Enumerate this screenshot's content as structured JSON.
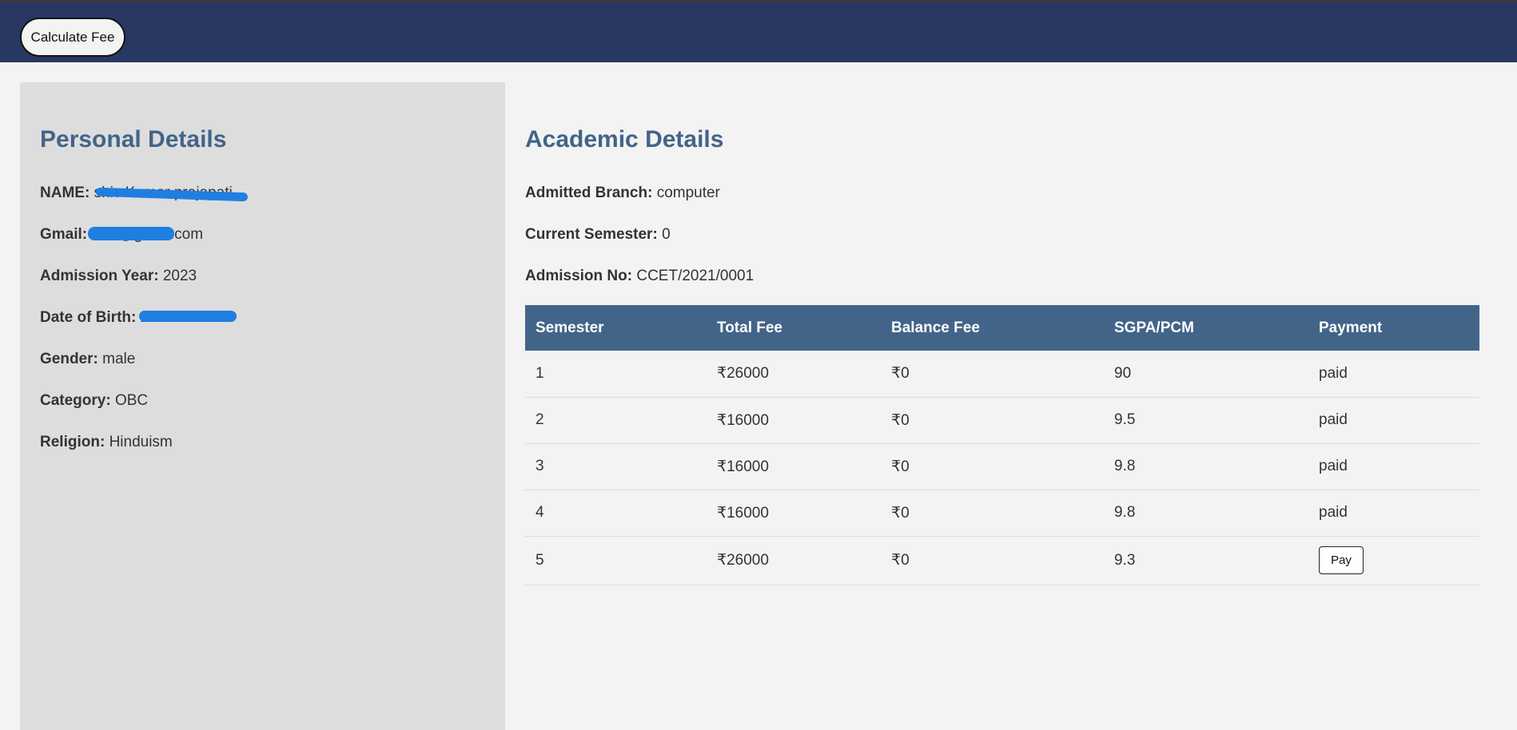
{
  "header": {
    "calculate_fee_label": "Calculate Fee",
    "background_color": "#283862"
  },
  "personal": {
    "title": "Personal Details",
    "fields": [
      {
        "label": "NAME:",
        "value": "shiv Kumar prajapati"
      },
      {
        "label": "Gmail:",
        "value": "shiv@gmail.com"
      },
      {
        "label": "Admission Year:",
        "value": "2023"
      },
      {
        "label": "Date of Birth:",
        "value": "2002-08-00"
      },
      {
        "label": "Gender:",
        "value": "male"
      },
      {
        "label": "Category:",
        "value": "OBC"
      },
      {
        "label": "Religion:",
        "value": "Hinduism"
      }
    ]
  },
  "academic": {
    "title": "Academic Details",
    "fields": [
      {
        "label": "Admitted Branch:",
        "value": "computer"
      },
      {
        "label": "Current Semester:",
        "value": "0"
      },
      {
        "label": "Admission No:",
        "value": "CCET/2021/0001"
      }
    ],
    "table": {
      "headers": [
        "Semester",
        "Total Fee",
        "Balance Fee",
        "SGPA/PCM",
        "Payment"
      ],
      "rows": [
        {
          "semester": "1",
          "total_fee": "₹26000",
          "balance_fee": "₹0",
          "sgpa": "90",
          "payment": "paid"
        },
        {
          "semester": "2",
          "total_fee": "₹16000",
          "balance_fee": "₹0",
          "sgpa": "9.5",
          "payment": "paid"
        },
        {
          "semester": "3",
          "total_fee": "₹16000",
          "balance_fee": "₹0",
          "sgpa": "9.8",
          "payment": "paid"
        },
        {
          "semester": "4",
          "total_fee": "₹16000",
          "balance_fee": "₹0",
          "sgpa": "9.8",
          "payment": "paid"
        },
        {
          "semester": "5",
          "total_fee": "₹26000",
          "balance_fee": "₹0",
          "sgpa": "9.3",
          "payment_button": "Pay"
        }
      ]
    }
  },
  "colors": {
    "accent": "#436489",
    "panel": "#dddddd",
    "redaction": "#1f7fe0"
  }
}
